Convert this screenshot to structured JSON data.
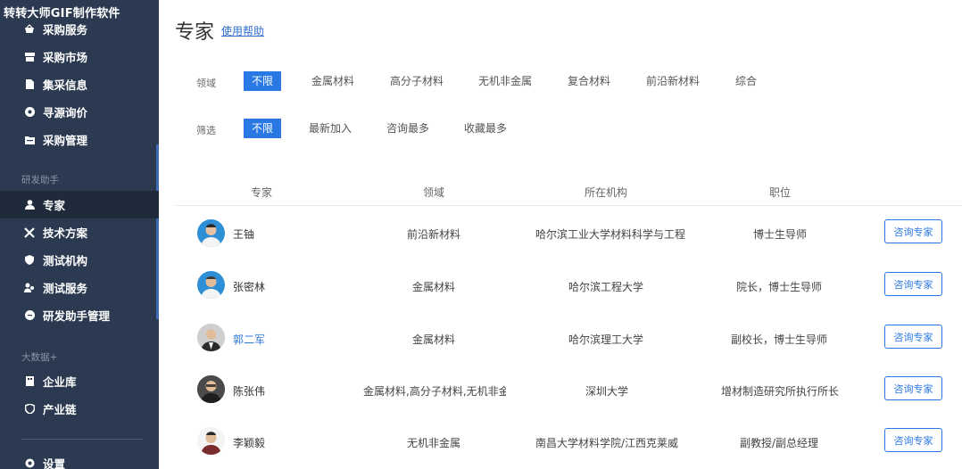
{
  "watermark": "转转大师GIF制作软件",
  "sidebar": {
    "purchase_items": [
      {
        "label": "采购服务",
        "icon": "basket-icon"
      },
      {
        "label": "采购市场",
        "icon": "market-icon"
      },
      {
        "label": "集采信息",
        "icon": "document-icon"
      },
      {
        "label": "寻源询价",
        "icon": "target-icon"
      },
      {
        "label": "采购管理",
        "icon": "folder-icon"
      }
    ],
    "section_research": "研发助手",
    "research_items": [
      {
        "label": "专家",
        "icon": "user-icon"
      },
      {
        "label": "技术方案",
        "icon": "tools-icon"
      },
      {
        "label": "测试机构",
        "icon": "shield-icon"
      },
      {
        "label": "测试服务",
        "icon": "users-icon"
      },
      {
        "label": "研发助手管理",
        "icon": "circle-icon"
      }
    ],
    "section_bigdata": "大数据+",
    "bigdata_items": [
      {
        "label": "企业库",
        "icon": "building-icon"
      },
      {
        "label": "产业链",
        "icon": "chain-icon"
      }
    ],
    "settings_label": "设置"
  },
  "header": {
    "title": "专家",
    "help_link": "使用帮助"
  },
  "filters": {
    "field_label": "领域",
    "field_options": [
      "不限",
      "金属材料",
      "高分子材料",
      "无机非金属",
      "复合材料",
      "前沿新材料",
      "综合"
    ],
    "field_selected": "不限",
    "sort_label": "筛选",
    "sort_options": [
      "不限",
      "最新加入",
      "咨询最多",
      "收藏最多"
    ],
    "sort_selected": "不限"
  },
  "table": {
    "columns": [
      "专家",
      "领域",
      "所在机构",
      "职位"
    ],
    "action_label": "咨询专家",
    "rows": [
      {
        "name": "王铀",
        "field": "前沿新材料",
        "institution": "哈尔滨工业大学材料科学与工程",
        "position": "博士生导师"
      },
      {
        "name": "张密林",
        "field": "金属材料",
        "institution": "哈尔滨工程大学",
        "position": "院长，博士生导师"
      },
      {
        "name": "郭二军",
        "field": "金属材料",
        "institution": "哈尔滨理工大学",
        "position": "副校长，博士生导师"
      },
      {
        "name": "陈张伟",
        "field": "金属材料,高分子材料,无机非金属",
        "institution": "深圳大学",
        "position": "增材制造研究所执行所长"
      },
      {
        "name": "李颖毅",
        "field": "无机非金属",
        "institution": "南昌大学材料学院/江西克莱威",
        "position": "副教授/副总经理"
      }
    ]
  },
  "colors": {
    "sidebar_bg": "#2b3a50",
    "sidebar_active": "#1f2a3b",
    "accent": "#2a78e4",
    "link": "#2f6fd0"
  }
}
